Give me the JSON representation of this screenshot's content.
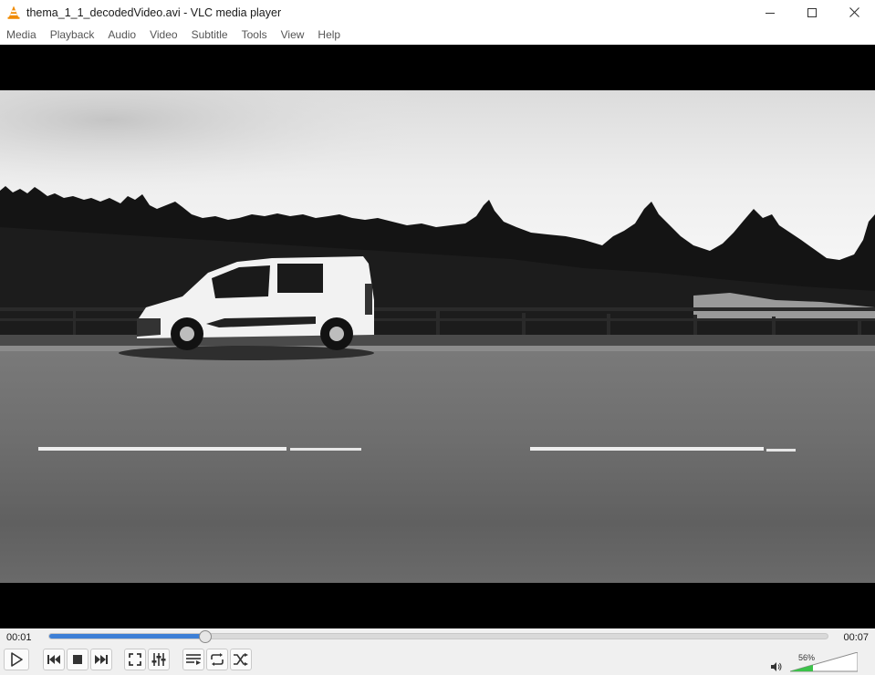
{
  "window": {
    "title": "thema_1_1_decodedVideo.avi - VLC media player",
    "app_icon": "vlc-cone-icon"
  },
  "menu": {
    "items": [
      "Media",
      "Playback",
      "Audio",
      "Video",
      "Subtitle",
      "Tools",
      "View",
      "Help"
    ]
  },
  "player": {
    "elapsed": "00:01",
    "total": "00:07",
    "progress": 0.2,
    "volume_label": "56%",
    "volume": 0.56
  },
  "buttons": {
    "play": "play-icon",
    "previous": "previous-icon",
    "stop": "stop-icon",
    "next": "next-icon",
    "fullscreen": "fullscreen-icon",
    "extended": "equalizer-icon",
    "playlist": "playlist-icon",
    "loop": "loop-icon",
    "random": "shuffle-icon"
  },
  "colors": {
    "accent": "#3d7fd6",
    "volume_fill": "#3cc24a",
    "vlc_orange": "#f08a00"
  }
}
